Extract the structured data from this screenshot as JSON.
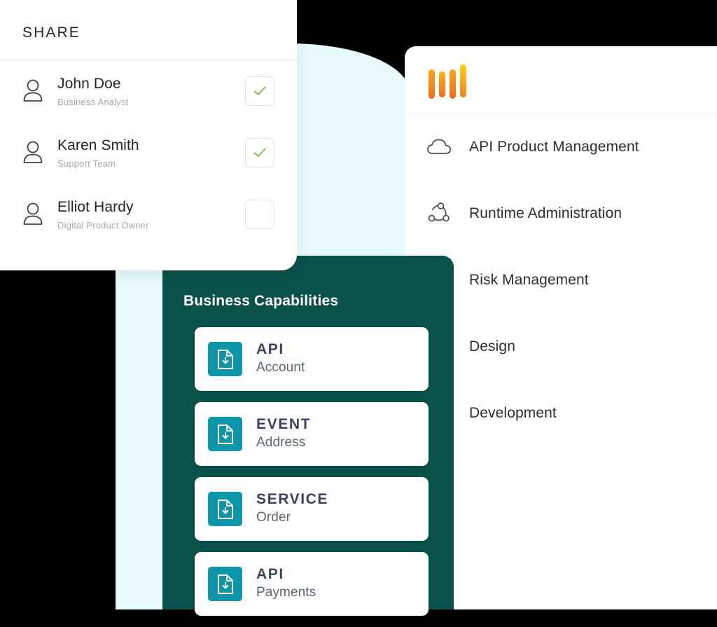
{
  "share_panel": {
    "title": "SHARE",
    "people": [
      {
        "name": "John Doe",
        "role": "Business Analyst",
        "checked": true,
        "avatar_icon": "person-icon",
        "check_icon": "check-icon"
      },
      {
        "name": "Karen Smith",
        "role": "Support Team",
        "checked": true,
        "avatar_icon": "person-icon",
        "check_icon": "check-icon"
      },
      {
        "name": "Elliot Hardy",
        "role": "Digital Product Owner",
        "checked": false,
        "avatar_icon": "person-icon",
        "check_icon": ""
      }
    ]
  },
  "nav_panel": {
    "logo_icon": "four-bars-logo-icon",
    "items": [
      {
        "label": "API Product Management",
        "icon": "cloud-icon"
      },
      {
        "label": "Runtime Administration",
        "icon": "network-nodes-icon"
      },
      {
        "label": "Risk Management",
        "icon": ""
      },
      {
        "label": "Design",
        "icon": ""
      },
      {
        "label": "Development",
        "icon": ""
      }
    ]
  },
  "capabilities_panel": {
    "title": "Business Capabilities",
    "cards": [
      {
        "kind": "API",
        "name": "Account",
        "icon": "document-download-icon"
      },
      {
        "kind": "EVENT",
        "name": "Address",
        "icon": "document-download-icon"
      },
      {
        "kind": "SERVICE",
        "name": "Order",
        "icon": "document-download-icon"
      },
      {
        "kind": "API",
        "name": "Payments",
        "icon": "document-download-icon"
      }
    ]
  },
  "colors": {
    "green_panel": "#0A5249",
    "teal_icon": "#0D96AA",
    "cyan_backdrop": "#E8FBFC",
    "check_green": "#7DC242",
    "logo_orange": "#F47B20",
    "logo_yellow": "#FDB913",
    "card_kind_text": "#3B4260"
  }
}
